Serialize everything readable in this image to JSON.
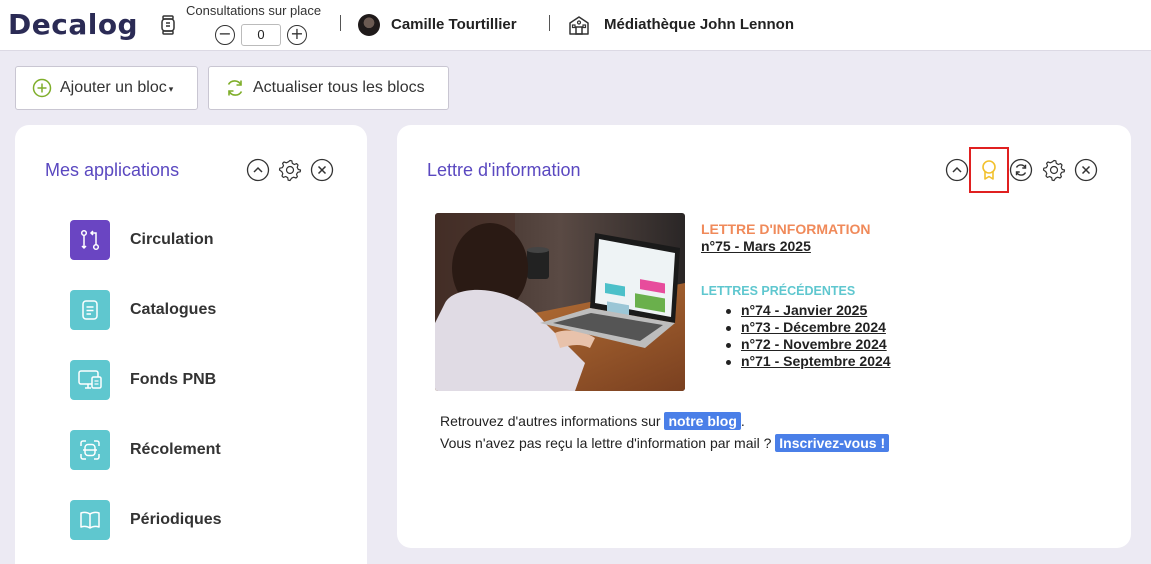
{
  "header": {
    "logo": "Decalog",
    "consult_label": "Consultations sur place",
    "consult_value": "0",
    "minus": "−",
    "plus": "+",
    "user_name": "Camille Tourtillier",
    "library_name": "Médiathèque John Lennon"
  },
  "toolbar": {
    "add_label": "Ajouter un bloc",
    "refresh_label": "Actualiser tous les blocs"
  },
  "apps": {
    "title": "Mes applications",
    "items": [
      {
        "label": "Circulation",
        "icon": "circulation-icon"
      },
      {
        "label": "Catalogues",
        "icon": "catalog-icon"
      },
      {
        "label": "Fonds PNB",
        "icon": "pnb-icon"
      },
      {
        "label": "Récolement",
        "icon": "recolement-icon"
      },
      {
        "label": "Périodiques",
        "icon": "book-icon"
      }
    ]
  },
  "newsletter": {
    "title": "Lettre d'information",
    "heading": "LETTRE D'INFORMATION",
    "current": "n°75 - Mars 2025",
    "prev_heading": "LETTRES PRÉCÉDENTES",
    "previous": [
      "n°74 - Janvier 2025",
      "n°73 - Décembre 2024",
      "n°72 - Novembre 2024",
      "n°71 - Septembre 2024"
    ],
    "line1_text": "Retrouvez d'autres informations sur ",
    "line1_link": "notre blog",
    "line1_end": ".",
    "line2_text": "Vous n'avez pas reçu la lettre d'information par mail ? ",
    "line2_link": "Inscrivez-vous !"
  },
  "colors": {
    "accent": "#5a48c0",
    "teal": "#5fc7cf",
    "orange": "#f08a5a",
    "link_blue": "#4a7fe8",
    "badge_yellow": "#f2c12e"
  }
}
